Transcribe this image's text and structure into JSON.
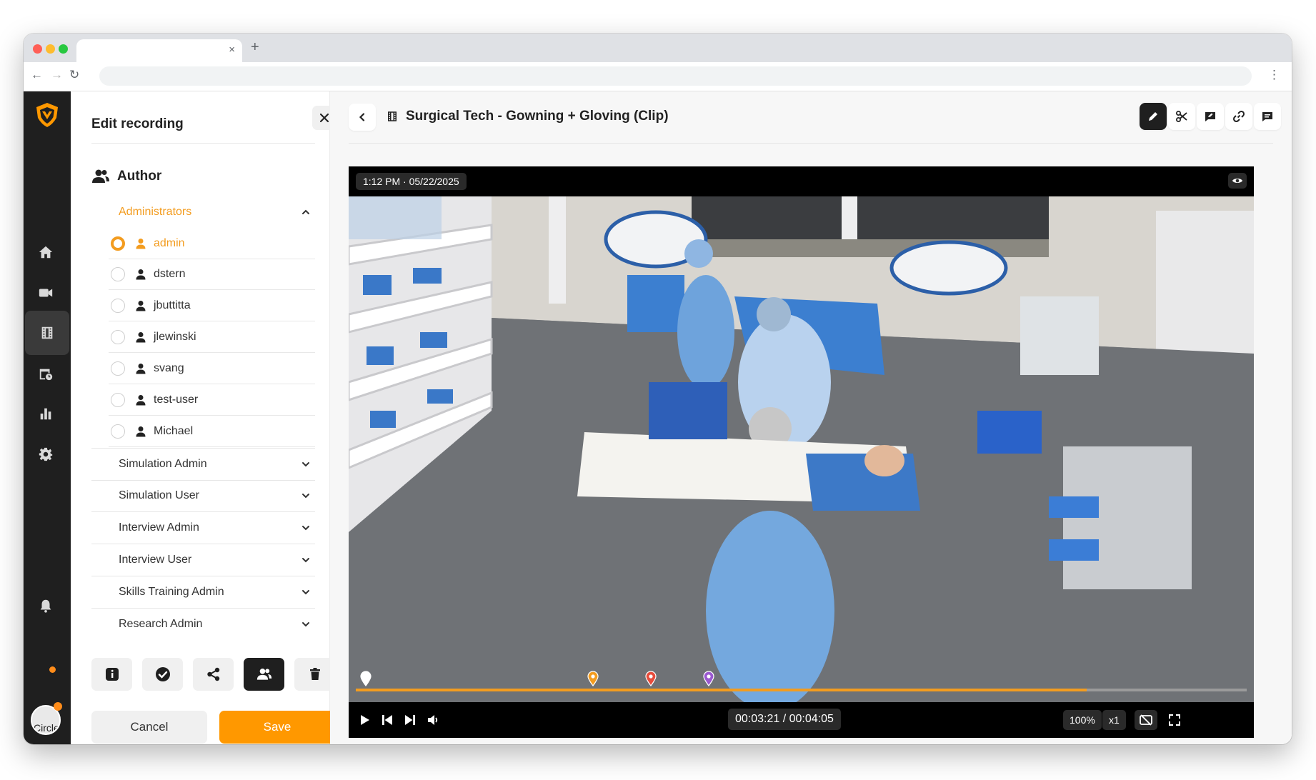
{
  "panel": {
    "title": "Edit recording",
    "author_heading": "Author",
    "groups": [
      {
        "label": "Administrators",
        "open": true
      },
      {
        "label": "Simulation Admin"
      },
      {
        "label": "Simulation User"
      },
      {
        "label": "Interview Admin"
      },
      {
        "label": "Interview User"
      },
      {
        "label": "Skills Training Admin"
      },
      {
        "label": "Research Admin"
      }
    ],
    "users": [
      {
        "name": "admin",
        "selected": true
      },
      {
        "name": "dstern"
      },
      {
        "name": "jbuttitta"
      },
      {
        "name": "jlewinski"
      },
      {
        "name": "svang"
      },
      {
        "name": "test-user"
      },
      {
        "name": "Michael"
      }
    ],
    "cancel_label": "Cancel",
    "save_label": "Save"
  },
  "main": {
    "title": "Surgical Tech - Gowning + Gloving (Clip)"
  },
  "video": {
    "timestamp": "1:12 PM · 05/22/2025",
    "time_display": "00:03:21 / 00:04:05",
    "progress": 0.82,
    "zoom": "100%",
    "speed": "x1",
    "markers": [
      {
        "position": 0.005,
        "color": "#ffffff"
      },
      {
        "position": 0.26,
        "color": "#f39c1f"
      },
      {
        "position": 0.325,
        "color": "#e74c3c"
      },
      {
        "position": 0.39,
        "color": "#9b59d0"
      }
    ]
  },
  "avatar": {
    "text": "Circle"
  },
  "colors": {
    "accent": "#ff9800",
    "dark": "#1f1f1f"
  }
}
